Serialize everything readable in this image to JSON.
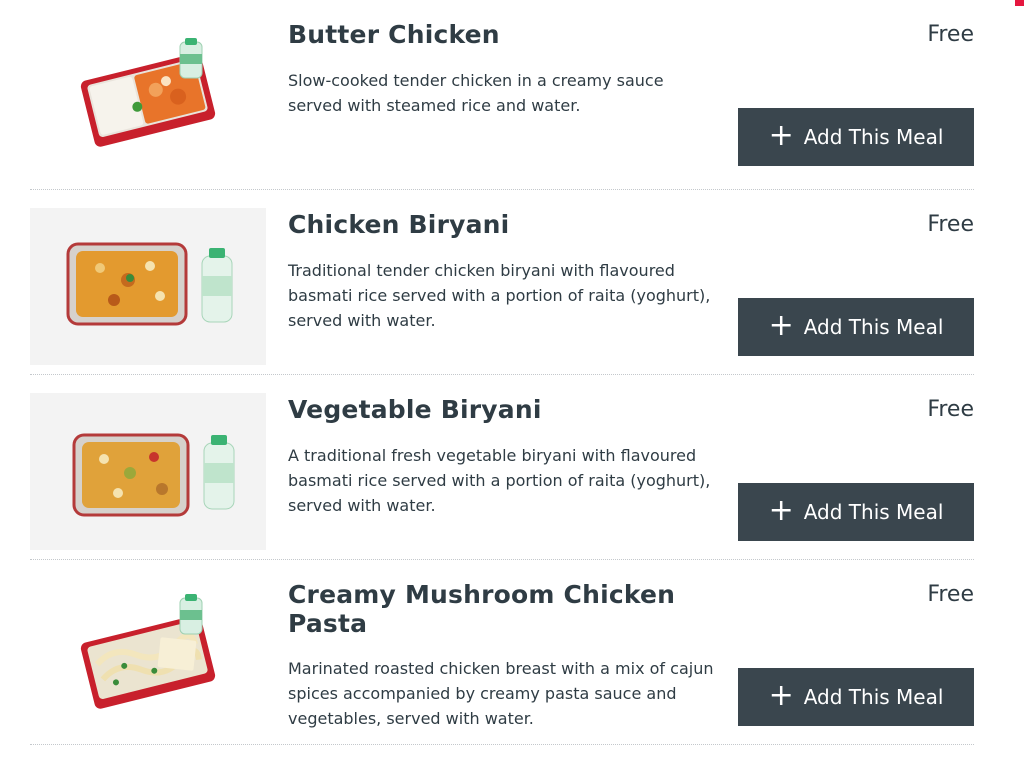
{
  "meals": [
    {
      "title": "Butter Chicken",
      "description": "Slow-cooked tender chicken in a creamy sauce served with steamed rice and water.",
      "price": "Free",
      "button_label": "Add This Meal",
      "button_icon": "plus-icon"
    },
    {
      "title": "Chicken Biryani",
      "description": "Traditional tender chicken biryani with flavoured basmati rice served with a portion of raita (yoghurt), served with water.",
      "price": "Free",
      "button_label": "Add This Meal",
      "button_icon": "plus-icon"
    },
    {
      "title": "Vegetable Biryani",
      "description": "A traditional fresh vegetable biryani with flavoured basmati rice served with a portion of raita (yoghurt), served with water.",
      "price": "Free",
      "button_label": "Add This Meal",
      "button_icon": "plus-icon"
    },
    {
      "title": "Creamy Mushroom Chicken Pasta",
      "description": "Marinated roasted chicken breast with a mix of cajun spices accompanied by creamy pasta sauce and vegetables, served with water.",
      "price": "Free",
      "button_label": "Add This Meal",
      "button_icon": "plus-icon"
    }
  ],
  "colors": {
    "accent": "#e5173f",
    "button_bg": "#3a464e",
    "text": "#2f3c44",
    "divider": "#c4c8cc"
  }
}
